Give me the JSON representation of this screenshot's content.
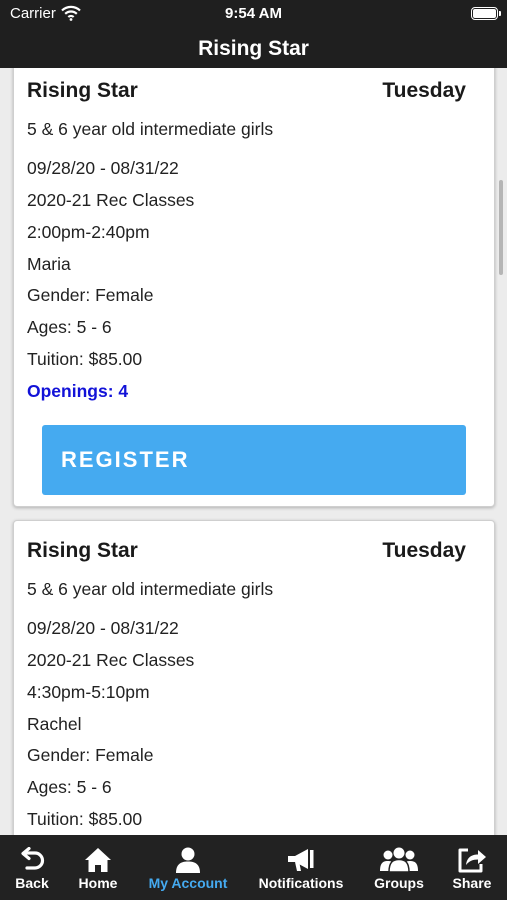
{
  "status_bar": {
    "carrier": "Carrier",
    "time": "9:54 AM"
  },
  "header": {
    "title": "Rising Star"
  },
  "classes": [
    {
      "name": "Rising Star",
      "day": "Tuesday",
      "description": "5 & 6 year old intermediate girls",
      "dates": "09/28/20 - 08/31/22",
      "session": "2020-21 Rec Classes",
      "time": "2:00pm-2:40pm",
      "instructor": "Maria",
      "gender": "Gender: Female",
      "ages": "Ages: 5 - 6",
      "tuition": "Tuition: $85.00",
      "openings": "Openings: 4",
      "register_label": "REGISTER"
    },
    {
      "name": "Rising Star",
      "day": "Tuesday",
      "description": "5 & 6 year old intermediate girls",
      "dates": "09/28/20 - 08/31/22",
      "session": "2020-21 Rec Classes",
      "time": "4:30pm-5:10pm",
      "instructor": "Rachel",
      "gender": "Gender: Female",
      "ages": "Ages: 5 - 6",
      "tuition": "Tuition: $85.00"
    }
  ],
  "tabbar": {
    "active": "My Account",
    "accent_color": "#45aaf0",
    "tabs": [
      {
        "label": "Back",
        "icon": "back-arrow-icon"
      },
      {
        "label": "Home",
        "icon": "home-icon"
      },
      {
        "label": "My Account",
        "icon": "user-icon"
      },
      {
        "label": "Notifications",
        "icon": "megaphone-icon"
      },
      {
        "label": "Groups",
        "icon": "group-icon"
      },
      {
        "label": "Share",
        "icon": "share-icon"
      }
    ]
  }
}
